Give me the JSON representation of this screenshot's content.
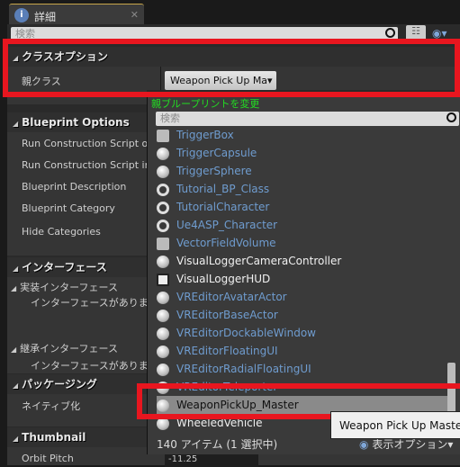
{
  "tab": {
    "title": "詳細",
    "icon": "info-icon"
  },
  "search": {
    "placeholder": "検索"
  },
  "class_options": {
    "header": "クラスオプション",
    "parent_class_label": "親クラス",
    "parent_class_value": "Weapon Pick Up Ma"
  },
  "blueprint_options": {
    "header": "Blueprint Options",
    "rows": [
      "Run Construction Script on",
      "Run Construction Script in S",
      "Blueprint Description",
      "Blueprint Category",
      "Hide Categories"
    ]
  },
  "interfaces": {
    "header": "インターフェース",
    "implemented": "実装インターフェース",
    "no_interfaces": "インターフェースがありませ",
    "inherited": "継承インターフェース",
    "no_interfaces2": "インターフェースがありませ"
  },
  "packaging": {
    "header": "パッケージング",
    "nativize": "ネイティブ化"
  },
  "thumbnail": {
    "header": "Thumbnail",
    "orbit_pitch": "Orbit Pitch",
    "orbit_pitch_value": "-11.25"
  },
  "popup": {
    "title": "親ブループリントを変更",
    "search_placeholder": "検索",
    "items": [
      {
        "label": "TriggerBox",
        "icon": "trigger-box-icon"
      },
      {
        "label": "TriggerCapsule",
        "icon": "trigger-capsule-icon"
      },
      {
        "label": "TriggerSphere",
        "icon": "trigger-sphere-icon"
      },
      {
        "label": "Tutorial_BP_Class",
        "icon": "blueprint-ring-icon"
      },
      {
        "label": "TutorialCharacter",
        "icon": "blueprint-ring-icon"
      },
      {
        "label": "Ue4ASP_Character",
        "icon": "blueprint-ring-icon"
      },
      {
        "label": "VectorFieldVolume",
        "icon": "vector-field-icon"
      },
      {
        "label": "VisualLoggerCameraController",
        "icon": "camera-controller-icon"
      },
      {
        "label": "VisualLoggerHUD",
        "icon": "hud-icon"
      },
      {
        "label": "VREditorAvatarActor",
        "icon": "actor-ball-icon"
      },
      {
        "label": "VREditorBaseActor",
        "icon": "actor-ball-icon"
      },
      {
        "label": "VREditorDockableWindow",
        "icon": "actor-ball-icon"
      },
      {
        "label": "VREditorFloatingUI",
        "icon": "actor-ball-icon"
      },
      {
        "label": "VREditorRadialFloatingUI",
        "icon": "actor-ball-icon"
      },
      {
        "label": "VREditorTeleporter",
        "icon": "actor-ball-icon"
      },
      {
        "label": "WeaponPickUp_Master",
        "icon": "actor-ball-icon",
        "selected": true
      },
      {
        "label": "WheeledVehicle",
        "icon": "wheeled-vehicle-icon"
      }
    ],
    "count": "140 アイテム (1 選択中)",
    "view_options": "表示オプション",
    "tooltip": "Weapon Pick Up Master"
  },
  "colors": {
    "highlight": "#e8161f",
    "link": "#6f9ccf",
    "title_green": "#22dd22"
  }
}
